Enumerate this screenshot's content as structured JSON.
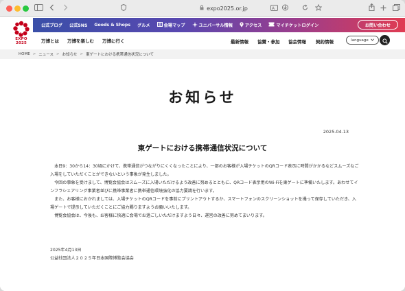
{
  "browser": {
    "url": "expo2025.or.jp",
    "icons": [
      "sidebar-icon",
      "back-icon",
      "forward-icon",
      "shield-icon",
      "translate-icon",
      "download-icon",
      "refresh-icon",
      "star-icon",
      "share-icon",
      "new-tab-icon",
      "tabs-icon"
    ]
  },
  "logo": {
    "line1": "EXPO",
    "line2": "2025"
  },
  "topbar": {
    "items": [
      "公式ブログ",
      "公式SNS",
      "Goods & Shops",
      "グルメ",
      "会場マップ",
      "ユニバーサル情報",
      "アクセス",
      "マイチケットログイン"
    ],
    "contact": "お問い合わせ"
  },
  "nav": {
    "left": [
      "万博とは",
      "万博を楽しむ",
      "万博に行く"
    ],
    "right": [
      "最新情報",
      "協賛・参加",
      "協会情報",
      "契約情報"
    ],
    "language": "language"
  },
  "breadcrumb": [
    "HOME",
    "ニュース",
    "お知らせ",
    "東ゲートにおける携帯通信状況について"
  ],
  "page": {
    "title": "お知らせ",
    "date": "2025.04.13",
    "article_title": "東ゲートにおける携帯通信状況について",
    "paragraphs": [
      "本日9：30から14：30頃にかけて、携帯通信がつながりにくくなったことにより、一部のお客様が入場チケットのQRコード表示に時間がかかるなどスムーズなご入場をしていただくことができないという事象が発生しました。",
      "今回の事象を受けまして、博覧会協会はスムーズに入場いただけるよう改善に努めるとともに、QRコード表示用のWi-Fiを東ゲートに準備いたします。あわせてインフラシェアリング事業者並びに携帯事業者に携帯通信環境強化の協力要請を行います。",
      "また、お客様におかれましては、入場チケットのQRコードを事前にプリントアウトするか、スマートフォンのスクリーンショットを撮って保存していただき、入場ゲートで提示していただくことにご協力賜りますようお願いいたします。",
      "博覧会協会は、今後も、お客様に快適に会場でお過ごしいただけますよう日々、運営の改善に努めてまいります。"
    ],
    "sign_date": "2025年4月13日",
    "sign_org": "公益社団法人２０２５年日本国際博覧会協会"
  },
  "colors": {
    "brand_red": "#c4001a",
    "gradient_start": "#3a4fa8",
    "gradient_end": "#e03c52"
  }
}
